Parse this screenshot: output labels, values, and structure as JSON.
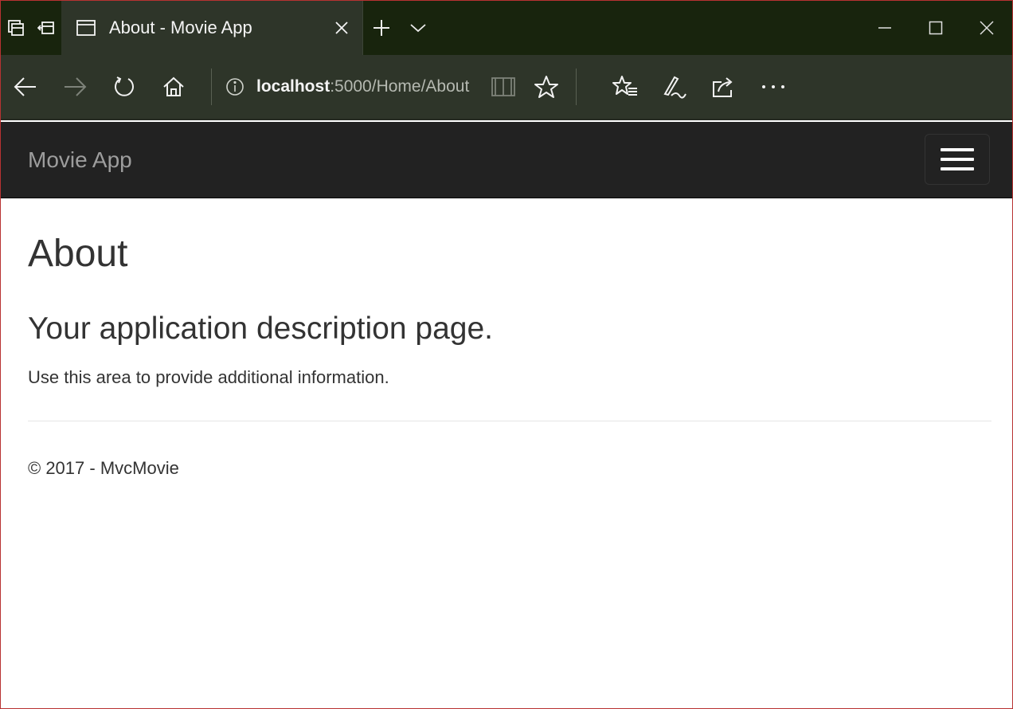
{
  "browser": {
    "tab": {
      "title": "About - Movie App"
    },
    "address": {
      "host": "localhost",
      "path": ":5000/Home/About"
    },
    "icons": {
      "set_aside_tabs": "set-aside-tabs-icon",
      "restore_tabs": "restore-tabs-icon",
      "tab_page": "page-icon",
      "close": "close-icon",
      "new_tab": "plus-icon",
      "tab_list": "chevron-down-icon",
      "minimize": "minimize-icon",
      "maximize": "maximize-icon",
      "window_close": "close-icon",
      "back": "back-arrow-icon",
      "forward": "forward-arrow-icon",
      "refresh": "refresh-icon",
      "home": "home-icon",
      "info": "info-icon",
      "reading_view": "book-icon",
      "favorite": "star-icon",
      "favorites_hub": "favorites-list-icon",
      "web_note": "pen-icon",
      "share": "share-icon",
      "more": "more-icon"
    }
  },
  "navbar": {
    "brand": "Movie App"
  },
  "page": {
    "heading": "About",
    "subheading": "Your application description page.",
    "body": "Use this area to provide additional information.",
    "footer": "© 2017 - MvcMovie"
  },
  "colors": {
    "tabbar_bg": "#18240d",
    "toolbar_bg": "#2e3529",
    "navbar_bg": "#222222",
    "brand_text": "#9d9d9d",
    "body_text": "#333333",
    "window_border": "#b83232"
  }
}
